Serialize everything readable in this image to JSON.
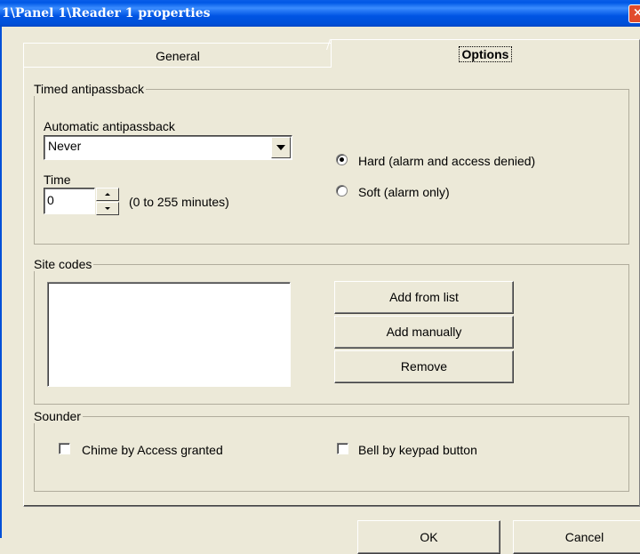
{
  "window": {
    "title": "1\\Panel 1\\Reader 1 properties",
    "close_glyph": "×"
  },
  "tabs": [
    {
      "label": "General",
      "selected": false
    },
    {
      "label": "Options",
      "selected": true
    }
  ],
  "timed_antipassback": {
    "legend": "Timed antipassback",
    "automatic_label": "Automatic antipassback",
    "automatic_value": "Never",
    "time_label": "Time",
    "time_value": "0",
    "time_range": "(0 to 255 minutes)",
    "mode_options": [
      {
        "label": "Hard (alarm and access denied)",
        "checked": true
      },
      {
        "label": "Soft (alarm only)",
        "checked": false
      }
    ]
  },
  "site_codes": {
    "legend": "Site codes",
    "buttons": {
      "add_from_list": "Add from list",
      "add_manually": "Add manually",
      "remove": "Remove"
    }
  },
  "sounder": {
    "legend": "Sounder",
    "options": [
      {
        "label": "Chime by Access granted",
        "checked": false
      },
      {
        "label": "Bell by keypad button",
        "checked": false
      }
    ]
  },
  "footer": {
    "ok_label": "OK",
    "cancel_label": "Cancel"
  },
  "colors": {
    "dialog_bg": "#ece9d8",
    "title_bar": "#0054e3",
    "close_button": "#e14c2c"
  }
}
